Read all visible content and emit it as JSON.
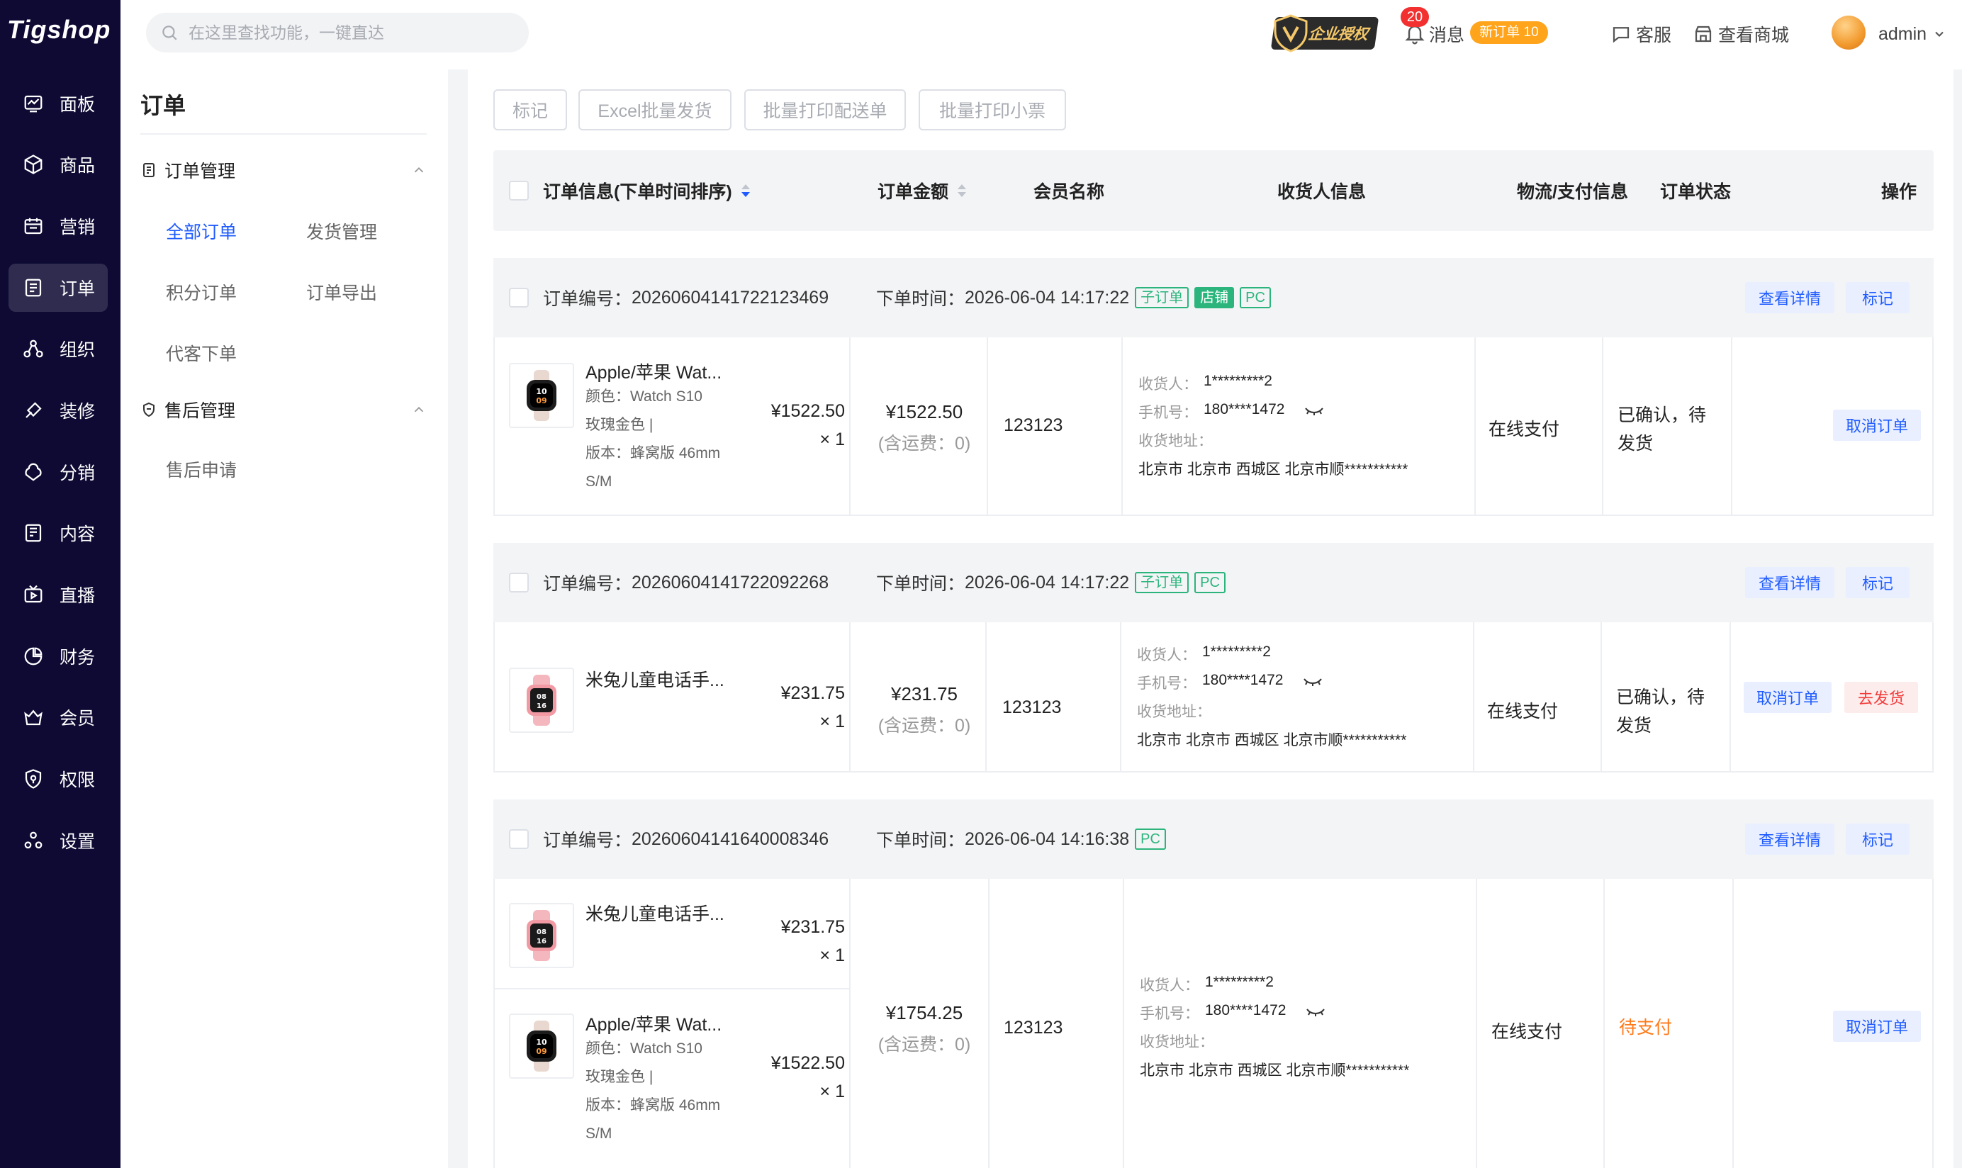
{
  "app": {
    "logo": "Tigshop"
  },
  "nav": [
    {
      "label": "面板",
      "icon": "dashboard-icon"
    },
    {
      "label": "商品",
      "icon": "product-box-icon"
    },
    {
      "label": "营销",
      "icon": "marketing-icon"
    },
    {
      "label": "订单",
      "icon": "order-icon",
      "active": true
    },
    {
      "label": "组织",
      "icon": "organization-icon"
    },
    {
      "label": "装修",
      "icon": "decoration-icon"
    },
    {
      "label": "分销",
      "icon": "distribution-icon"
    },
    {
      "label": "内容",
      "icon": "content-icon"
    },
    {
      "label": "直播",
      "icon": "live-icon"
    },
    {
      "label": "财务",
      "icon": "finance-icon"
    },
    {
      "label": "会员",
      "icon": "member-icon"
    },
    {
      "label": "权限",
      "icon": "permission-icon"
    },
    {
      "label": "设置",
      "icon": "settings-icon"
    }
  ],
  "topbar": {
    "search_placeholder": "在这里查找功能，一键直达",
    "enterprise": "企业授权",
    "msg_count": "20",
    "msg_label": "消息",
    "new_order": "新订单 10",
    "service": "客服",
    "view_mall": "查看商城",
    "user": "admin"
  },
  "sidebar": {
    "title": "订单",
    "group1": "订单管理",
    "group1_links": [
      "全部订单",
      "发货管理",
      "积分订单",
      "订单导出",
      "代客下单"
    ],
    "group2": "售后管理",
    "group2_links": [
      "售后申请"
    ]
  },
  "toolbar": {
    "mark": "标记",
    "excel": "Excel批量发货",
    "print_delivery": "批量打印配送单",
    "print_receipt": "批量打印小票"
  },
  "table_header": {
    "info": "订单信息(下单时间排序)",
    "amount": "订单金额",
    "member": "会员名称",
    "receiver": "收货人信息",
    "logistics": "物流/支付信息",
    "status": "订单状态",
    "ops": "操作"
  },
  "labels": {
    "order_no": "订单编号：",
    "order_time": "下单时间：",
    "view": "查看详情",
    "mark": "标记",
    "receiver": "收货人：",
    "phone": "手机号：",
    "address": "收货地址：",
    "cancel": "取消订单",
    "ship": "去发货"
  },
  "orders": [
    {
      "no": "20260604141722123469",
      "time": "2026-06-04 14:17:22",
      "tags": [
        "子订单",
        "店铺",
        "PC"
      ],
      "items": [
        {
          "name": "Apple/苹果 Wat...",
          "attr1": "颜色：Watch S10",
          "attr2": "玫瑰金色 |",
          "attr3": "版本：蜂窝版 46mm",
          "attr4": "S/M",
          "price": "¥1522.50",
          "qty": "× 1"
        }
      ],
      "amount": "¥1522.50",
      "shipping": "(含运费：0)",
      "member": "123123",
      "consignee": "1*********2",
      "phone": "180****1472",
      "address": "北京市 北京市 西城区 北京市顺***********",
      "payment": "在线支付",
      "status": "已确认，待发货"
    },
    {
      "no": "20260604141722092268",
      "time": "2026-06-04 14:17:22",
      "tags": [
        "子订单",
        "PC"
      ],
      "items": [
        {
          "name": "米兔儿童电话手...",
          "price": "¥231.75",
          "qty": "× 1"
        }
      ],
      "amount": "¥231.75",
      "shipping": "(含运费：0)",
      "member": "123123",
      "consignee": "1*********2",
      "phone": "180****1472",
      "address": "北京市 北京市 西城区 北京市顺***********",
      "payment": "在线支付",
      "status": "已确认，待发货"
    },
    {
      "no": "20260604141640008346",
      "time": "2026-06-04 14:16:38",
      "tags": [
        "PC"
      ],
      "items": [
        {
          "name": "米兔儿童电话手...",
          "price": "¥231.75",
          "qty": "× 1"
        },
        {
          "name": "Apple/苹果 Wat...",
          "attr1": "颜色：Watch S10",
          "attr2": "玫瑰金色 |",
          "attr3": "版本：蜂窝版 46mm",
          "attr4": "S/M",
          "price": "¥1522.50",
          "qty": "× 1"
        }
      ],
      "amount": "¥1754.25",
      "shipping": "(含运费：0)",
      "member": "123123",
      "consignee": "1*********2",
      "phone": "180****1472",
      "address": "北京市 北京市 西城区 北京市顺***********",
      "payment": "在线支付",
      "status": "待支付"
    }
  ]
}
